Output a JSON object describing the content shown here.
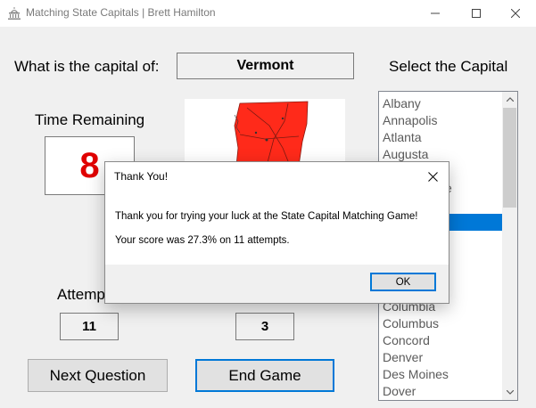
{
  "window": {
    "title": "Matching State Capitals  | Brett Hamilton",
    "app_icon": "capitol-building-icon",
    "minimize_icon": "minimize-icon",
    "maximize_icon": "maximize-icon",
    "close_icon": "close-icon"
  },
  "question": {
    "prompt": "What is the capital of:",
    "state": "Vermont",
    "select_label": "Select the Capital"
  },
  "timer": {
    "label": "Time Remaining",
    "value": "8",
    "value_color": "#e00000"
  },
  "map": {
    "state_fill": "#ff2a1a"
  },
  "stats": {
    "attempts_label": "Attempts",
    "attempts_value": "11",
    "correct_value": "3"
  },
  "buttons": {
    "next_label": "Next Question",
    "end_label": "End Game"
  },
  "capitals": {
    "items": [
      "Albany",
      "Annapolis",
      "Atlanta",
      "Augusta",
      "",
      "",
      "",
      "",
      "",
      "",
      "",
      "",
      "Columbia",
      "Columbus",
      "Concord",
      "Denver",
      "Des Moines",
      "Dover"
    ],
    "selected_index": 7,
    "partial_item_text": "e",
    "scroll_up_icon": "chevron-up-icon",
    "scroll_down_icon": "chevron-down-icon"
  },
  "dialog": {
    "title": "Thank You!",
    "message1": "Thank you for trying your luck at the State Capital Matching Game!",
    "message2": "Your score was 27.3% on 11 attempts.",
    "ok_label": "OK"
  },
  "colors": {
    "accent": "#0078d7",
    "window_bg": "#f0f0f0"
  }
}
